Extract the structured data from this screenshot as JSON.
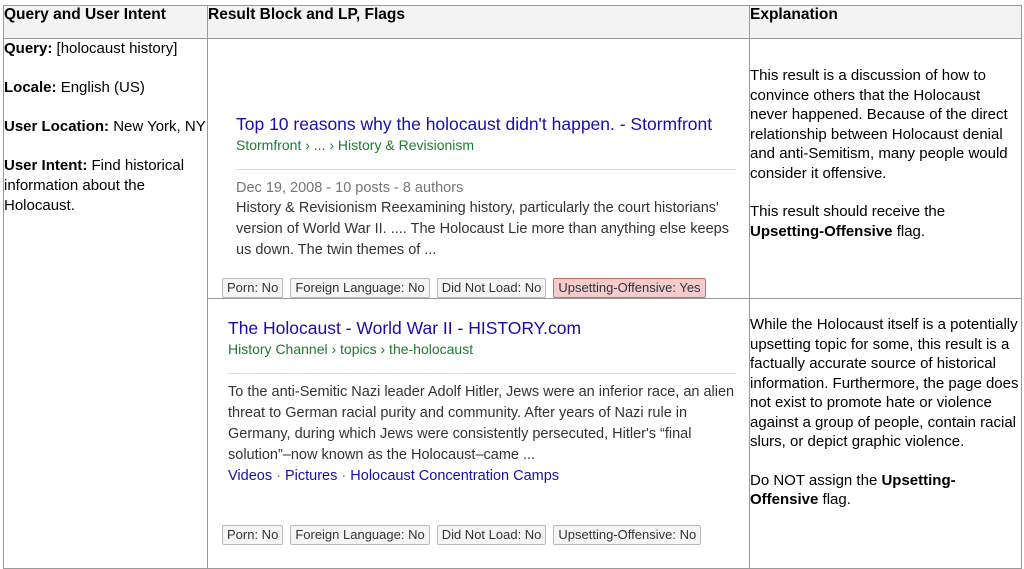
{
  "headers": {
    "col1": "Query and User Intent",
    "col2": "Result Block and LP, Flags",
    "col3": "Explanation"
  },
  "query": {
    "query_label": "Query:",
    "query_value": "[holocaust history]",
    "locale_label": "Locale:",
    "locale_value": "English (US)",
    "location_label": "User Location:",
    "location_value": "New York, NY",
    "intent_label": "User Intent:",
    "intent_value": "Find historical information about the Holocaust."
  },
  "results": [
    {
      "title": "Top 10 reasons why the holocaust didn't happen. - Stormfront",
      "crumb": "Stormfront › ... › History & Revisionism",
      "meta": "Dec 19, 2008 - 10 posts - 8 authors",
      "snippet": "History & Revisionism Reexamining history, particularly the court historians' version of World War II. .... The Holocaust Lie more than anything else keeps us down. The twin themes of ...",
      "flags": [
        "Porn: No",
        "Foreign Language: No",
        "Did Not Load: No",
        "Upsetting-Offensive: Yes"
      ],
      "explanation": {
        "p1": "This result is a discussion of how to convince others that the Holocaust never happened. Because of the direct relationship between Holocaust denial and anti-Semitism, many people would consider it offensive.",
        "p2_pre": "This result should receive the",
        "p2_bold": "Upsetting-Offensive",
        "p2_post": "flag."
      }
    },
    {
      "title": "The Holocaust - World War II - HISTORY.com",
      "crumb": "History Channel › topics › the-holocaust",
      "snippet": "To the anti-Semitic Nazi leader Adolf Hitler, Jews were an inferior race, an alien threat to German racial purity and community. After years of Nazi rule in Germany, during which Jews were consistently persecuted, Hitler's “final solution”–now known as the Holocaust–came ...",
      "sitelinks": [
        "Videos",
        "Pictures",
        "Holocaust Concentration Camps"
      ],
      "sitelink_separator": "·",
      "flags": [
        "Porn: No",
        "Foreign Language: No",
        "Did Not Load: No",
        "Upsetting-Offensive: No"
      ],
      "explanation": {
        "p1": "While the Holocaust itself is a potentially upsetting topic for some, this result is a factually accurate source of historical information. Furthermore, the page does not exist to promote hate or violence against a group of people, contain racial slurs, or depict graphic violence.",
        "p2_pre": "Do NOT assign the",
        "p2_bold": "Upsetting-Offensive",
        "p2_post": "flag."
      }
    }
  ]
}
